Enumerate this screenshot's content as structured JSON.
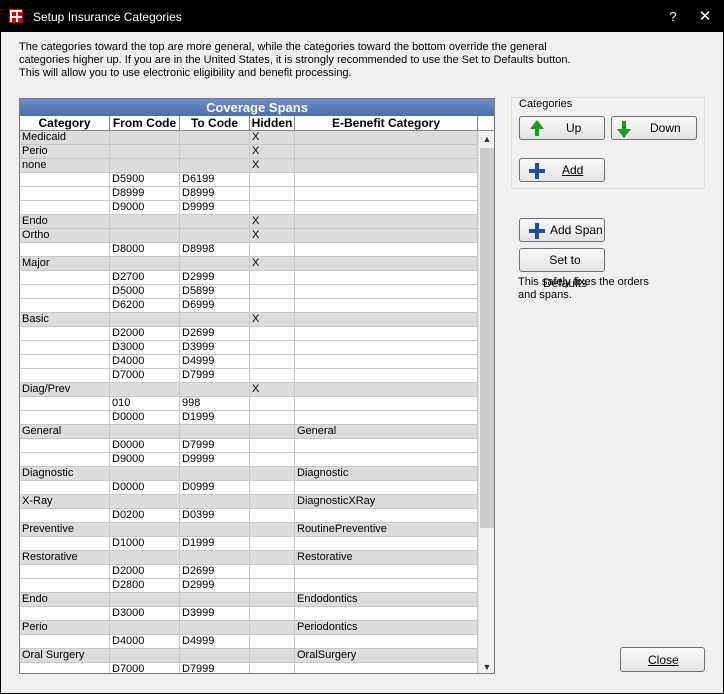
{
  "window": {
    "title": "Setup Insurance Categories",
    "help": "?",
    "close_glyph": "✕"
  },
  "intro": {
    "line1": "The categories toward the top are more general, while the categories toward the bottom override the general",
    "line2": "categories higher up.  If you are in the United States, it is strongly recommended to use the Set to Defaults button.",
    "line3": "This will allow you to use electronic eligibility and benefit processing."
  },
  "grid": {
    "title": "Coverage Spans",
    "columns": [
      "Category",
      "From Code",
      "To Code",
      "Hidden",
      "E-Benefit Category"
    ],
    "rows": [
      {
        "category": "Medicaid",
        "from": "",
        "to": "",
        "hidden": "X",
        "ebenefit": "",
        "is_category": true
      },
      {
        "category": "Perio",
        "from": "",
        "to": "",
        "hidden": "X",
        "ebenefit": "",
        "is_category": true
      },
      {
        "category": "none",
        "from": "",
        "to": "",
        "hidden": "X",
        "ebenefit": "",
        "is_category": true
      },
      {
        "category": "",
        "from": "D5900",
        "to": "D6199",
        "hidden": "",
        "ebenefit": "",
        "is_category": false
      },
      {
        "category": "",
        "from": "D8999",
        "to": "D8999",
        "hidden": "",
        "ebenefit": "",
        "is_category": false
      },
      {
        "category": "",
        "from": "D9000",
        "to": "D9999",
        "hidden": "",
        "ebenefit": "",
        "is_category": false
      },
      {
        "category": "Endo",
        "from": "",
        "to": "",
        "hidden": "X",
        "ebenefit": "",
        "is_category": true
      },
      {
        "category": "Ortho",
        "from": "",
        "to": "",
        "hidden": "X",
        "ebenefit": "",
        "is_category": true
      },
      {
        "category": "",
        "from": "D8000",
        "to": "D8998",
        "hidden": "",
        "ebenefit": "",
        "is_category": false
      },
      {
        "category": "Major",
        "from": "",
        "to": "",
        "hidden": "X",
        "ebenefit": "",
        "is_category": true
      },
      {
        "category": "",
        "from": "D2700",
        "to": "D2999",
        "hidden": "",
        "ebenefit": "",
        "is_category": false
      },
      {
        "category": "",
        "from": "D5000",
        "to": "D5899",
        "hidden": "",
        "ebenefit": "",
        "is_category": false
      },
      {
        "category": "",
        "from": "D6200",
        "to": "D6999",
        "hidden": "",
        "ebenefit": "",
        "is_category": false
      },
      {
        "category": "Basic",
        "from": "",
        "to": "",
        "hidden": "X",
        "ebenefit": "",
        "is_category": true
      },
      {
        "category": "",
        "from": "D2000",
        "to": "D2699",
        "hidden": "",
        "ebenefit": "",
        "is_category": false
      },
      {
        "category": "",
        "from": "D3000",
        "to": "D3999",
        "hidden": "",
        "ebenefit": "",
        "is_category": false
      },
      {
        "category": "",
        "from": "D4000",
        "to": "D4999",
        "hidden": "",
        "ebenefit": "",
        "is_category": false
      },
      {
        "category": "",
        "from": "D7000",
        "to": "D7999",
        "hidden": "",
        "ebenefit": "",
        "is_category": false
      },
      {
        "category": "Diag/Prev",
        "from": "",
        "to": "",
        "hidden": "X",
        "ebenefit": "",
        "is_category": true
      },
      {
        "category": "",
        "from": "010",
        "to": "998",
        "hidden": "",
        "ebenefit": "",
        "is_category": false
      },
      {
        "category": "",
        "from": "D0000",
        "to": "D1999",
        "hidden": "",
        "ebenefit": "",
        "is_category": false
      },
      {
        "category": "General",
        "from": "",
        "to": "",
        "hidden": "",
        "ebenefit": "General",
        "is_category": true
      },
      {
        "category": "",
        "from": "D0000",
        "to": "D7999",
        "hidden": "",
        "ebenefit": "",
        "is_category": false
      },
      {
        "category": "",
        "from": "D9000",
        "to": "D9999",
        "hidden": "",
        "ebenefit": "",
        "is_category": false
      },
      {
        "category": "Diagnostic",
        "from": "",
        "to": "",
        "hidden": "",
        "ebenefit": "Diagnostic",
        "is_category": true
      },
      {
        "category": "",
        "from": "D0000",
        "to": "D0999",
        "hidden": "",
        "ebenefit": "",
        "is_category": false
      },
      {
        "category": "X-Ray",
        "from": "",
        "to": "",
        "hidden": "",
        "ebenefit": "DiagnosticXRay",
        "is_category": true
      },
      {
        "category": "",
        "from": "D0200",
        "to": "D0399",
        "hidden": "",
        "ebenefit": "",
        "is_category": false
      },
      {
        "category": "Preventive",
        "from": "",
        "to": "",
        "hidden": "",
        "ebenefit": "RoutinePreventive",
        "is_category": true
      },
      {
        "category": "",
        "from": "D1000",
        "to": "D1999",
        "hidden": "",
        "ebenefit": "",
        "is_category": false
      },
      {
        "category": "Restorative",
        "from": "",
        "to": "",
        "hidden": "",
        "ebenefit": "Restorative",
        "is_category": true
      },
      {
        "category": "",
        "from": "D2000",
        "to": "D2699",
        "hidden": "",
        "ebenefit": "",
        "is_category": false
      },
      {
        "category": "",
        "from": "D2800",
        "to": "D2999",
        "hidden": "",
        "ebenefit": "",
        "is_category": false
      },
      {
        "category": "Endo",
        "from": "",
        "to": "",
        "hidden": "",
        "ebenefit": "Endodontics",
        "is_category": true
      },
      {
        "category": "",
        "from": "D3000",
        "to": "D3999",
        "hidden": "",
        "ebenefit": "",
        "is_category": false
      },
      {
        "category": "Perio",
        "from": "",
        "to": "",
        "hidden": "",
        "ebenefit": "Periodontics",
        "is_category": true
      },
      {
        "category": "",
        "from": "D4000",
        "to": "D4999",
        "hidden": "",
        "ebenefit": "",
        "is_category": false
      },
      {
        "category": "Oral Surgery",
        "from": "",
        "to": "",
        "hidden": "",
        "ebenefit": "OralSurgery",
        "is_category": true
      },
      {
        "category": "",
        "from": "D7000",
        "to": "D7999",
        "hidden": "",
        "ebenefit": "",
        "is_category": false
      }
    ]
  },
  "categories_group": {
    "label": "Categories",
    "up_label": "Up",
    "down_label": "Down",
    "add_label": "Add"
  },
  "add_span_label": "Add Span",
  "set_defaults_label": "Set to Defaults",
  "note": "This safely fixes the orders and spans.",
  "close_label": "Close",
  "colors": {
    "title_bar": "#000000",
    "grid_title": "#4a6fae",
    "category_row": "#dcdcdc",
    "arrow_green": "#1a9a1a",
    "plus_blue": "#1f4fa0"
  }
}
